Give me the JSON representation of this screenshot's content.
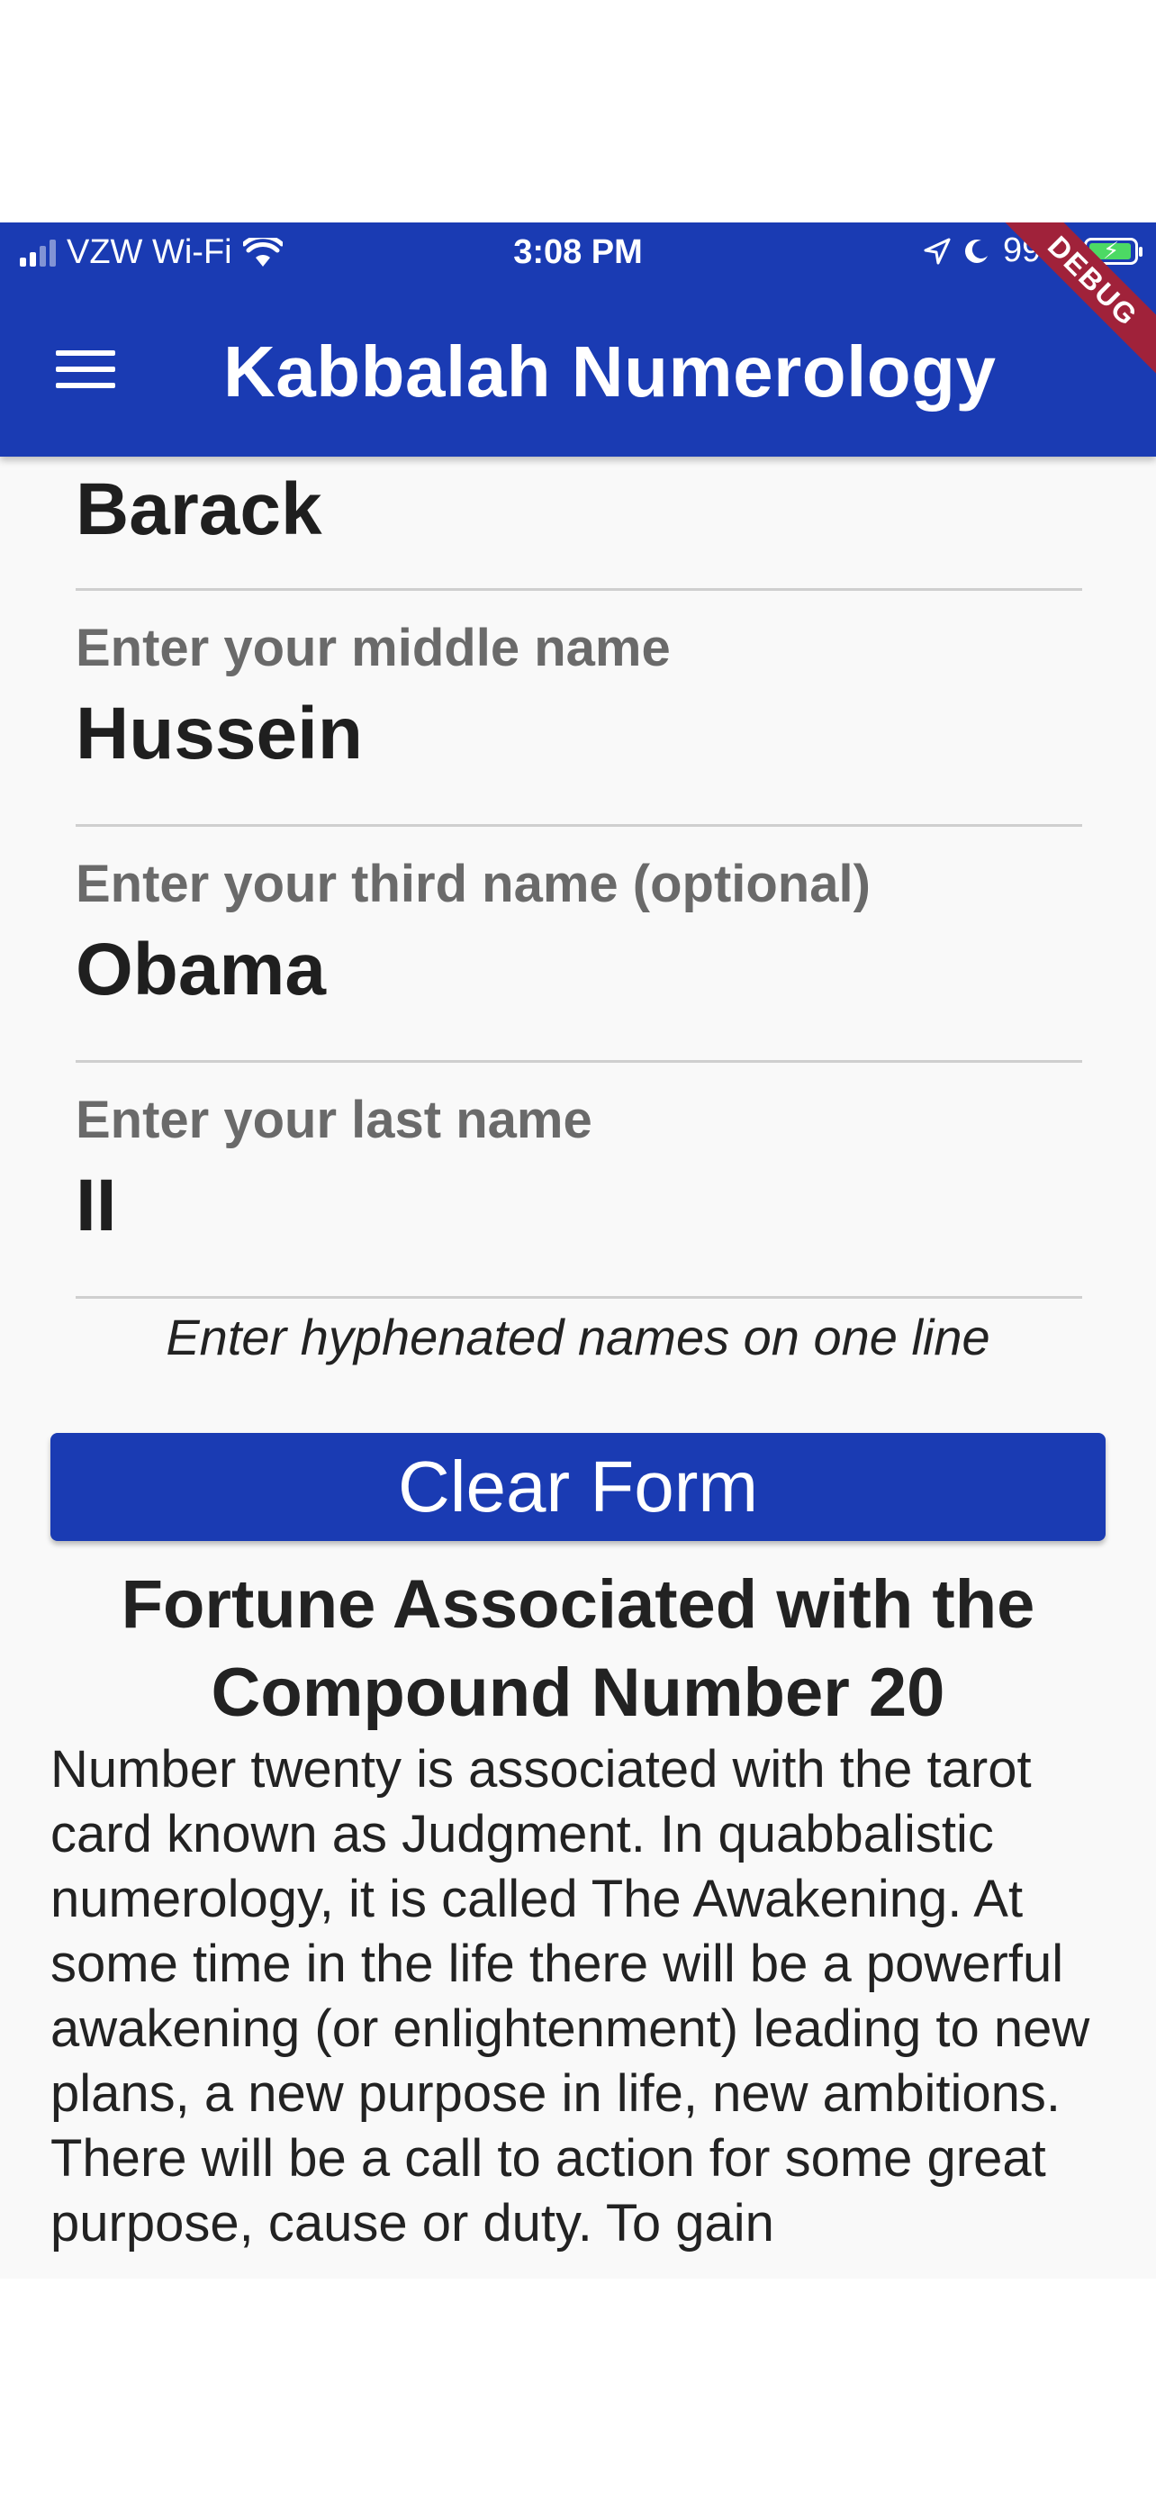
{
  "status_bar": {
    "carrier": "VZW Wi-Fi",
    "time": "3:08 PM",
    "battery": "99%"
  },
  "app_bar": {
    "title": "Kabbalah Numerology",
    "debug_label": "DEBUG"
  },
  "form": {
    "first_value": "Barack",
    "middle_label": "Enter your middle name",
    "middle_value": "Hussein",
    "third_label": "Enter your third name (optional)",
    "third_value": "Obama",
    "last_label": "Enter your last name",
    "last_value": "II",
    "hint": "Enter hyphenated names on one line",
    "clear_button": "Clear Form"
  },
  "result": {
    "heading": "Fortune Associated with the Compound Number 20",
    "body": "Number twenty is associated with the tarot card known as Judgment. In quabbalistic numerology, it is called The Awakening. At some time in the life there will be a powerful awakening (or enlightenment) leading to new plans, a new purpose in life, new ambitions. There will be a call to action for some great purpose, cause or duty. To gain"
  }
}
